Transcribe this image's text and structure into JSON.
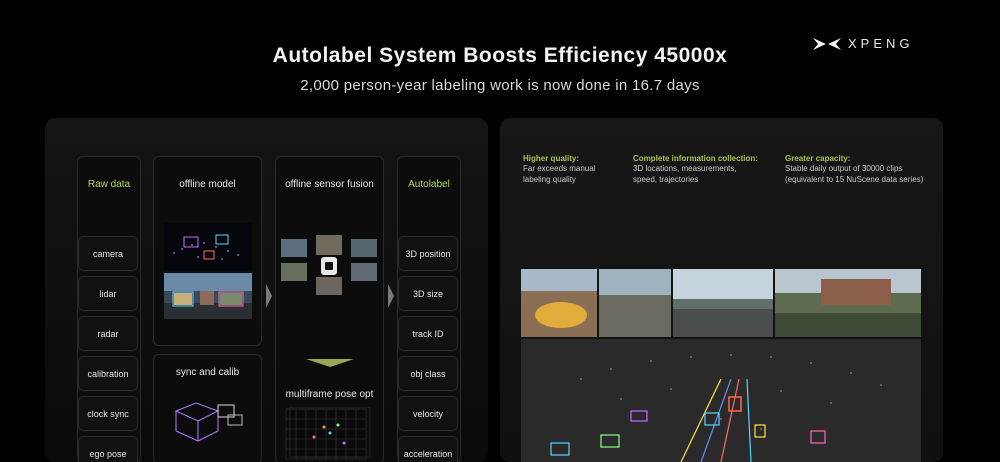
{
  "header": {
    "title": "Autolabel System Boosts Efficiency 45000x",
    "subtitle": "2,000 person-year labeling work is now done in 16.7 days",
    "brand": "XPENG"
  },
  "pipeline": {
    "raw_data": {
      "title": "Raw data",
      "items": [
        "camera",
        "lidar",
        "radar",
        "calibration",
        "clock sync",
        "ego pose"
      ]
    },
    "offline_model": {
      "title": "offline model"
    },
    "sync_calib": {
      "title": "sync and calib"
    },
    "sensor_fusion": {
      "title": "offline sensor fusion"
    },
    "pose_opt": {
      "title": "multiframe pose opt"
    },
    "autolabel": {
      "title": "Autolabel",
      "items": [
        "3D position",
        "3D size",
        "track ID",
        "obj class",
        "velocity",
        "acceleration"
      ]
    }
  },
  "benefits": [
    {
      "heading": "Higher quality:",
      "body": [
        "Far exceeds manual",
        "labeling quality"
      ]
    },
    {
      "heading": "Complete information collection:",
      "body": [
        "3D locations, measurements,",
        "speed, trajectories"
      ]
    },
    {
      "heading": "Greater capacity:",
      "body": [
        "Stable daily output of 30000 clips",
        "(equivalent to 15 NuScene data series)"
      ]
    }
  ],
  "colors": {
    "accent": "#b8d65a",
    "background": "#000000"
  }
}
